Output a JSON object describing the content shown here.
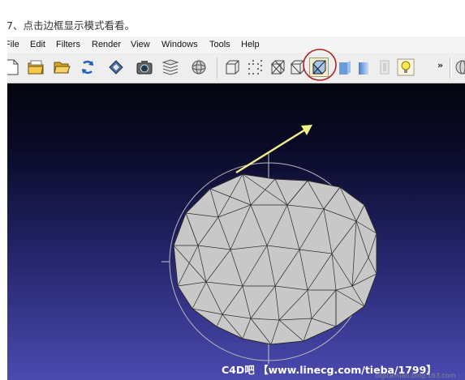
{
  "step_caption": "7、点击边框显示模式看看。",
  "menubar": {
    "items": [
      "File",
      "Edit",
      "Filters",
      "Render",
      "View",
      "Windows",
      "Tools",
      "Help"
    ]
  },
  "toolbar": {
    "more_label": "»",
    "buttons": [
      "new-file-icon",
      "open-layers-icon",
      "open-folder-icon",
      "reload-icon",
      "save-icon",
      "snapshot-camera-icon",
      "layer-stack-icon",
      "globe-icon",
      "bounding-box-icon",
      "points-icon",
      "wireframe-icon",
      "hidden-lines-icon",
      "flat-lines-icon",
      "flat-shading-icon",
      "smooth-shading-icon",
      "texture-icon",
      "light-bulb-icon"
    ],
    "active_button": "flat-lines-icon"
  },
  "viewport": {
    "watermark": "C4D吧 【www.linecg.com/tieba/1799】"
  },
  "credit": "digitalmao.blog.163.com",
  "colors": {
    "annotation_arrow": "#f0f08a",
    "annotation_circle": "#b02020",
    "mesh_fill": "#c8c8c8",
    "mesh_edges": "#2a2a2a"
  }
}
